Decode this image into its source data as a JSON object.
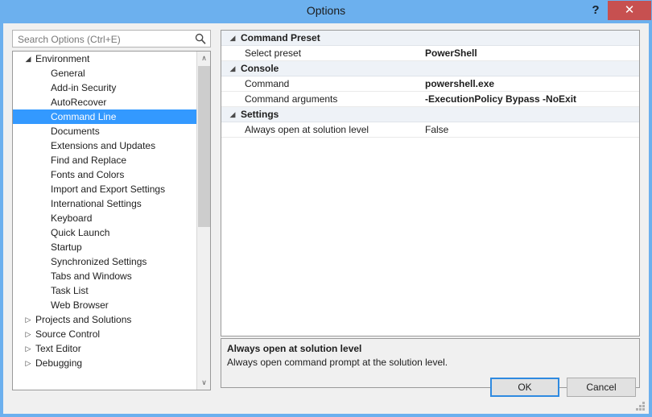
{
  "window": {
    "title": "Options",
    "help_label": "?",
    "close_label": "✕",
    "titlebar_color": "#6cb0ee",
    "close_color": "#c75050"
  },
  "search": {
    "placeholder": "Search Options (Ctrl+E)",
    "value": "",
    "icon": "search-icon"
  },
  "tree": {
    "selected_color": "#3399ff",
    "expanded_glyph": "◢",
    "collapsed_glyph": "▷",
    "scroll_up_glyph": "∧",
    "scroll_down_glyph": "∨",
    "items": [
      {
        "label": "Environment",
        "level": 0,
        "state": "expanded",
        "selected": false
      },
      {
        "label": "General",
        "level": 1,
        "state": "leaf",
        "selected": false
      },
      {
        "label": "Add-in Security",
        "level": 1,
        "state": "leaf",
        "selected": false
      },
      {
        "label": "AutoRecover",
        "level": 1,
        "state": "leaf",
        "selected": false
      },
      {
        "label": "Command Line",
        "level": 1,
        "state": "leaf",
        "selected": true
      },
      {
        "label": "Documents",
        "level": 1,
        "state": "leaf",
        "selected": false
      },
      {
        "label": "Extensions and Updates",
        "level": 1,
        "state": "leaf",
        "selected": false
      },
      {
        "label": "Find and Replace",
        "level": 1,
        "state": "leaf",
        "selected": false
      },
      {
        "label": "Fonts and Colors",
        "level": 1,
        "state": "leaf",
        "selected": false
      },
      {
        "label": "Import and Export Settings",
        "level": 1,
        "state": "leaf",
        "selected": false
      },
      {
        "label": "International Settings",
        "level": 1,
        "state": "leaf",
        "selected": false
      },
      {
        "label": "Keyboard",
        "level": 1,
        "state": "leaf",
        "selected": false
      },
      {
        "label": "Quick Launch",
        "level": 1,
        "state": "leaf",
        "selected": false
      },
      {
        "label": "Startup",
        "level": 1,
        "state": "leaf",
        "selected": false
      },
      {
        "label": "Synchronized Settings",
        "level": 1,
        "state": "leaf",
        "selected": false
      },
      {
        "label": "Tabs and Windows",
        "level": 1,
        "state": "leaf",
        "selected": false
      },
      {
        "label": "Task List",
        "level": 1,
        "state": "leaf",
        "selected": false
      },
      {
        "label": "Web Browser",
        "level": 1,
        "state": "leaf",
        "selected": false
      },
      {
        "label": "Projects and Solutions",
        "level": 0,
        "state": "collapsed",
        "selected": false
      },
      {
        "label": "Source Control",
        "level": 0,
        "state": "collapsed",
        "selected": false
      },
      {
        "label": "Text Editor",
        "level": 0,
        "state": "collapsed",
        "selected": false
      },
      {
        "label": "Debugging",
        "level": 0,
        "state": "collapsed",
        "selected": false
      }
    ]
  },
  "grid": {
    "category_glyph": "◢",
    "rows": [
      {
        "kind": "category",
        "label": "Command Preset"
      },
      {
        "kind": "prop",
        "name": "Select preset",
        "value": "PowerShell",
        "bold": true
      },
      {
        "kind": "category",
        "label": "Console"
      },
      {
        "kind": "prop",
        "name": "Command",
        "value": "powershell.exe",
        "bold": true
      },
      {
        "kind": "prop",
        "name": "Command arguments",
        "value": "-ExecutionPolicy Bypass -NoExit",
        "bold": true
      },
      {
        "kind": "category",
        "label": "Settings"
      },
      {
        "kind": "prop",
        "name": "Always open at solution level",
        "value": "False",
        "bold": false
      }
    ]
  },
  "description": {
    "title": "Always open at solution level",
    "text": "Always open command prompt at the solution level."
  },
  "buttons": {
    "ok_label": "OK",
    "cancel_label": "Cancel"
  }
}
